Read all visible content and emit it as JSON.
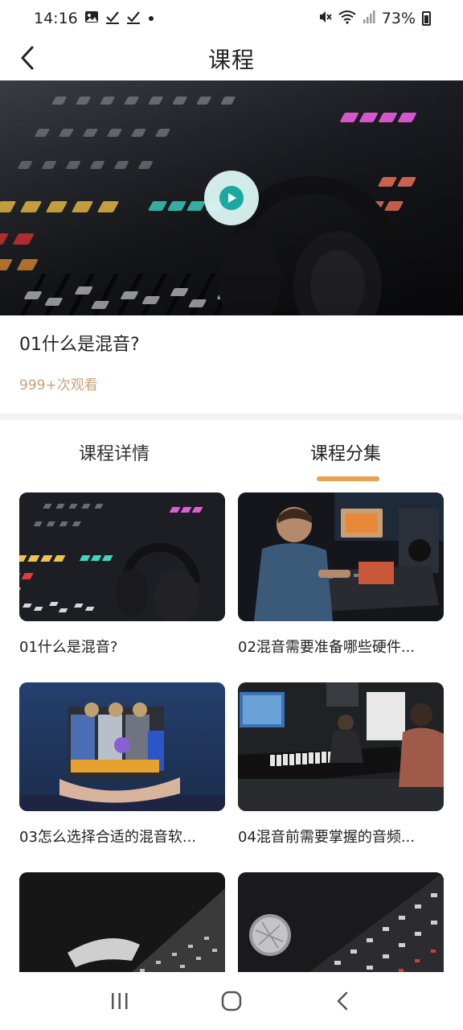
{
  "status_bar": {
    "time": "14:16",
    "battery": "73%",
    "icons": [
      "image-icon",
      "check-icon",
      "check-icon",
      "dot-icon",
      "mute-icon",
      "wifi-icon",
      "signal-icon",
      "battery-icon"
    ]
  },
  "header": {
    "title": "课程",
    "back_icon": "chevron-left-icon"
  },
  "video": {
    "title": "01什么是混音?",
    "views": "999+次观看",
    "play_icon": "play-icon"
  },
  "tabs": [
    {
      "label": "课程详情",
      "active": false
    },
    {
      "label": "课程分集",
      "active": true
    }
  ],
  "episodes": [
    {
      "title": "01什么是混音?",
      "thumb": "mixing-console-headphones"
    },
    {
      "title": "02混音需要准备哪些硬件...",
      "thumb": "studio-engineer"
    },
    {
      "title": "03怎么选择合适的混音软...",
      "thumb": "hands-holding-plugins"
    },
    {
      "title": "04混音前需要掌握的音频...",
      "thumb": "studio-keyboard"
    },
    {
      "title": "",
      "thumb": "hand-on-faders-bw"
    },
    {
      "title": "",
      "thumb": "microphone-console"
    }
  ],
  "colors": {
    "accent": "#e8a24f",
    "views_text": "#c8a27a",
    "play": "#1aa8a0",
    "divider": "#f3f3f3"
  },
  "nav_bar": {
    "icons": [
      "recents-icon",
      "home-icon",
      "back-icon"
    ]
  }
}
